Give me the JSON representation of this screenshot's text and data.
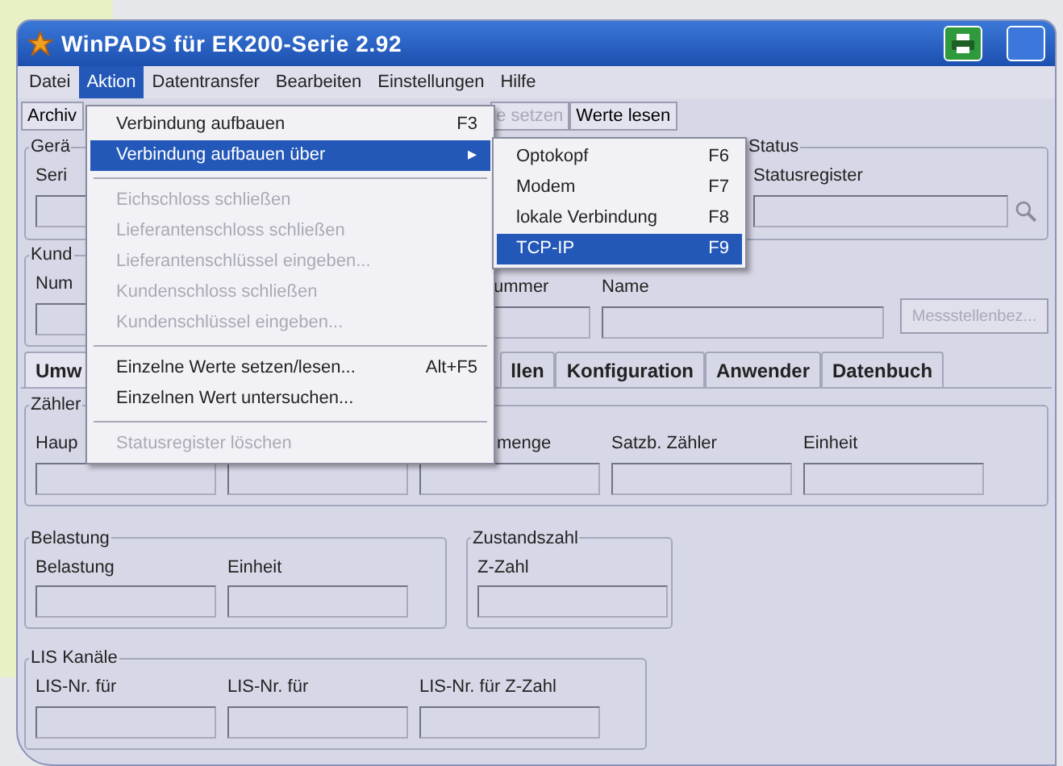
{
  "window": {
    "title": "WinPADS für EK200-Serie 2.92"
  },
  "menu_bar": [
    {
      "label": "Datei",
      "selected": false
    },
    {
      "label": "Aktion",
      "selected": true
    },
    {
      "label": "Datentransfer",
      "selected": false
    },
    {
      "label": "Bearbeiten",
      "selected": false
    },
    {
      "label": "Einstellungen",
      "selected": false
    },
    {
      "label": "Hilfe",
      "selected": false
    }
  ],
  "toolbar": [
    {
      "label": "Archiv",
      "disabled": false
    },
    {
      "label": "e setzen",
      "disabled": true
    },
    {
      "label": "Werte lesen",
      "disabled": false
    }
  ],
  "open_menu": {
    "items": [
      {
        "kind": "item",
        "label": "Verbindung aufbauen",
        "shortcut": "F3",
        "disabled": false,
        "selected": false
      },
      {
        "kind": "submenu",
        "label": "Verbindung aufbauen über",
        "arrow": "▸",
        "disabled": false,
        "selected": true
      },
      {
        "kind": "separator"
      },
      {
        "kind": "item",
        "label": "Eichschloss schließen",
        "disabled": true,
        "selected": false
      },
      {
        "kind": "item",
        "label": "Lieferantenschloss schließen",
        "disabled": true,
        "selected": false
      },
      {
        "kind": "item",
        "label": "Lieferantenschlüssel eingeben...",
        "disabled": true,
        "selected": false
      },
      {
        "kind": "item",
        "label": "Kundenschloss schließen",
        "disabled": true,
        "selected": false
      },
      {
        "kind": "item",
        "label": "Kundenschlüssel eingeben...",
        "disabled": true,
        "selected": false
      },
      {
        "kind": "separator"
      },
      {
        "kind": "item",
        "label": "Einzelne Werte setzen/lesen...",
        "shortcut": "Alt+F5",
        "disabled": false,
        "selected": false
      },
      {
        "kind": "item",
        "label": "Einzelnen Wert untersuchen...",
        "disabled": false,
        "selected": false
      },
      {
        "kind": "separator"
      },
      {
        "kind": "item",
        "label": "Statusregister löschen",
        "disabled": true,
        "selected": false
      }
    ]
  },
  "submenu": {
    "items": [
      {
        "label": "Optokopf",
        "shortcut": "F6",
        "selected": false
      },
      {
        "label": "Modem",
        "shortcut": "F7",
        "selected": false
      },
      {
        "label": "lokale Verbindung",
        "shortcut": "F8",
        "selected": false
      },
      {
        "label": "TCP-IP",
        "shortcut": "F9",
        "selected": true
      }
    ]
  },
  "device_group": {
    "legend": "Gerä",
    "label": "Seri"
  },
  "status_group": {
    "legend": "Status",
    "label": "Statusregister"
  },
  "customer_group": {
    "legend": "Kund",
    "label": "Num"
  },
  "measuring_point": {
    "labels": [
      "ummer",
      "Name"
    ],
    "button": {
      "label": "Messstellenbez...",
      "disabled": true
    }
  },
  "tabs": [
    {
      "label": "Umw",
      "selected": true
    },
    {
      "label": "llen",
      "selected": false
    },
    {
      "label": "Konfiguration",
      "selected": false
    },
    {
      "label": "Anwender",
      "selected": false
    },
    {
      "label": "Datenbuch",
      "selected": false
    }
  ],
  "counter_group": {
    "legend": "Zähler",
    "fields": [
      {
        "label": "Haup"
      },
      {
        "label": "menge"
      },
      {
        "label": "Satzb. Zähler"
      },
      {
        "label": "Einheit"
      }
    ]
  },
  "load_group": {
    "legend": "Belastung",
    "fields": [
      {
        "label": "Belastung"
      },
      {
        "label": "Einheit"
      }
    ]
  },
  "state_group": {
    "legend": "Zustandszahl",
    "fields": [
      {
        "label": "Z-Zahl"
      }
    ]
  },
  "lis_group": {
    "legend": "LIS Kanäle",
    "fields": [
      {
        "label": "LIS-Nr. für"
      },
      {
        "label": "LIS-Nr. für"
      },
      {
        "label": "LIS-Nr. für Z-Zahl"
      }
    ]
  }
}
